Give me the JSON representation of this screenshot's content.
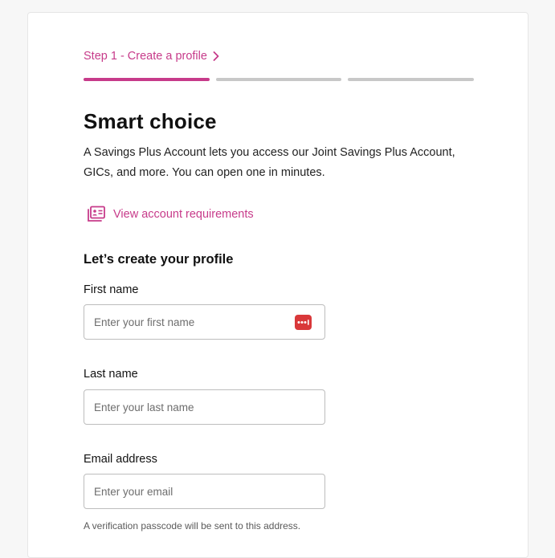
{
  "stepper": {
    "current_step_label": "Step 1 - Create a profile",
    "total_segments": 3,
    "active_segment": 1
  },
  "header": {
    "title": "Smart choice",
    "intro": "A Savings Plus Account lets you access our Joint Savings Plus Account, GICs, and more. You can open one in minutes."
  },
  "requirements_link": {
    "label": "View account requirements"
  },
  "profile_form": {
    "heading": "Let’s create your profile",
    "first_name": {
      "label": "First name",
      "placeholder": "Enter your first name",
      "value": ""
    },
    "last_name": {
      "label": "Last name",
      "placeholder": "Enter your last name",
      "value": ""
    },
    "email": {
      "label": "Email address",
      "placeholder": "Enter your email",
      "value": "",
      "helper": "A verification passcode will be sent to this address."
    }
  },
  "colors": {
    "accent": "#c73b8a",
    "progress_inactive": "#c8c8c8",
    "password_manager": "#d9383a"
  },
  "icons": {
    "step_chevron": "chevron-right-icon",
    "requirements": "id-card-documents-icon",
    "autofill": "password-manager-icon"
  }
}
